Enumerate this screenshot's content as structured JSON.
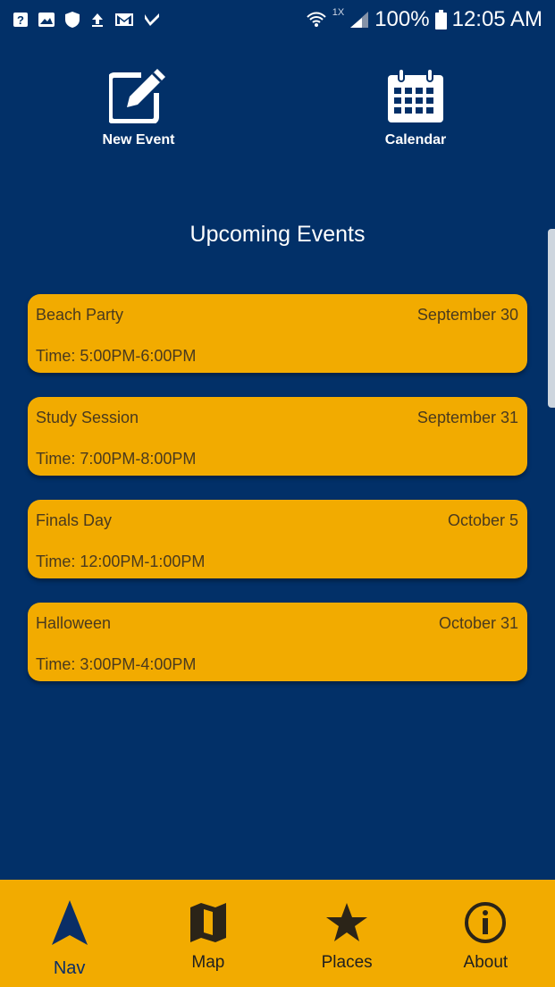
{
  "status_bar": {
    "battery": "100%",
    "time": "12:05 AM",
    "network_badge": "1X"
  },
  "quick_actions": {
    "new_event_label": "New Event",
    "calendar_label": "Calendar"
  },
  "section_title": "Upcoming Events",
  "events": [
    {
      "name": "Beach Party",
      "date": "September 30",
      "time": "Time: 5:00PM-6:00PM"
    },
    {
      "name": "Study Session",
      "date": "September 31",
      "time": "Time: 7:00PM-8:00PM"
    },
    {
      "name": "Finals Day",
      "date": "October 5",
      "time": "Time: 12:00PM-1:00PM"
    },
    {
      "name": "Halloween",
      "date": "October 31",
      "time": "Time: 3:00PM-4:00PM"
    }
  ],
  "bottom_nav": {
    "items": [
      {
        "label": "Nav",
        "icon": "navigation-arrow-icon"
      },
      {
        "label": "Map",
        "icon": "map-icon"
      },
      {
        "label": "Places",
        "icon": "star-icon"
      },
      {
        "label": "About",
        "icon": "info-icon"
      }
    ],
    "active": "Nav"
  },
  "colors": {
    "background": "#023068",
    "accent": "#f2ab00",
    "card_text": "#4a3a1e"
  }
}
